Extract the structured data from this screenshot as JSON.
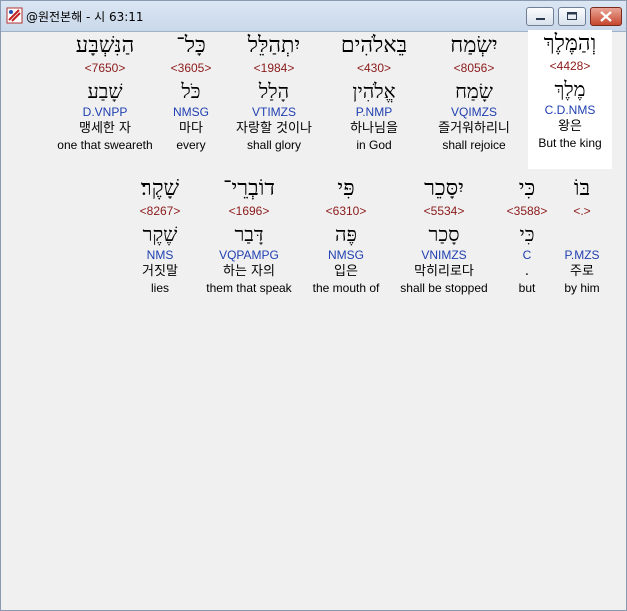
{
  "window": {
    "title": "@원전본해 - 시 63:11",
    "buttons": {
      "minimize": "minimize",
      "maximize": "maximize",
      "close": "close"
    }
  },
  "words": [
    {
      "hebrew": "וְהַמֶּלֶךְ",
      "strong": "<4428>",
      "root": "מֶלֶךְ",
      "parse": "C.D.NMS",
      "korean": "왕은",
      "english": "But the king",
      "selected": true
    },
    {
      "hebrew": "יִשְׂמַח",
      "strong": "<8056>",
      "root": "שָׂמַח",
      "parse": "VQIMZS",
      "korean": "즐거워하리니",
      "english": "shall rejoice",
      "selected": false
    },
    {
      "hebrew": "בֵּאלֹהִים",
      "strong": "<430>",
      "root": "אֱלֹהִין",
      "parse": "P.NMP",
      "korean": "하나님을",
      "english": "in God",
      "selected": false
    },
    {
      "hebrew": "יִתְהַלֵּל",
      "strong": "<1984>",
      "root": "הָלַל",
      "parse": "VTIMZS",
      "korean": "자랑할 것이나",
      "english": "shall glory",
      "selected": false
    },
    {
      "hebrew": "כָּל־",
      "strong": "<3605>",
      "root": "כֹּל",
      "parse": "NMSG",
      "korean": "마다",
      "english": "every",
      "selected": false
    },
    {
      "hebrew": "הַנִּשְׁבָּע",
      "strong": "<7650>",
      "root": "שָׁבַע",
      "parse": "D.VNPP",
      "korean": "맹세한 자",
      "english": "one that sweareth",
      "selected": false
    },
    {
      "hebrew": "בּוֹ",
      "strong": "<.>",
      "root": "",
      "parse": "P.MZS",
      "korean": "주로",
      "english": "by him",
      "selected": false
    },
    {
      "hebrew": "כִּי",
      "strong": "<3588>",
      "root": "כִּי",
      "parse": "C",
      "korean": ".",
      "english": "but",
      "selected": false
    },
    {
      "hebrew": "יִסָּכֵר",
      "strong": "<5534>",
      "root": "סָכַר",
      "parse": "VNIMZS",
      "korean": "막히리로다",
      "english": "shall be stopped",
      "selected": false
    },
    {
      "hebrew": "פִּי",
      "strong": "<6310>",
      "root": "פֶּה",
      "parse": "NMSG",
      "korean": "입은",
      "english": "the mouth of",
      "selected": false
    },
    {
      "hebrew": "דוֹבְרֵי־",
      "strong": "<1696>",
      "root": "דָּבַר",
      "parse": "VQPAMPG",
      "korean": "하는 자의",
      "english": "them that speak",
      "selected": false
    },
    {
      "hebrew": "שָׁקֶר׃",
      "strong": "<8267>",
      "root": "שֶׁקֶר",
      "parse": "NMS",
      "korean": "거짓말",
      "english": "lies",
      "selected": false
    }
  ]
}
